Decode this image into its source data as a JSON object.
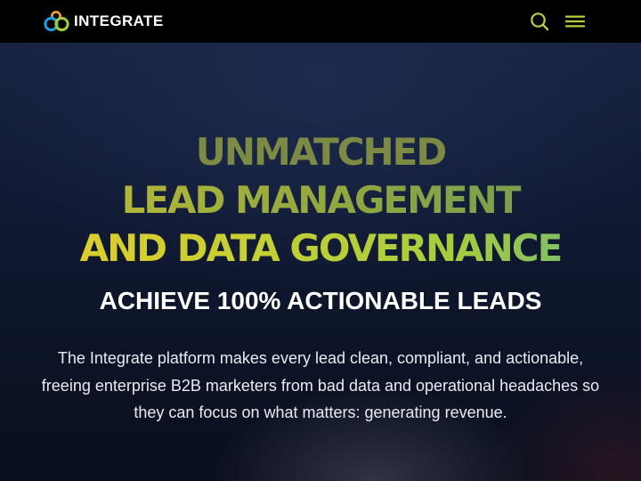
{
  "header": {
    "brand_name": "INTEGRATE",
    "logo_icon": "integrate-rings-logo-icon",
    "search_icon": "search-icon",
    "menu_icon": "hamburger-menu-icon",
    "accent_color": "#b5cf3f",
    "background_color": "#000000"
  },
  "hero": {
    "headline_lines": [
      "UNMATCHED",
      "LEAD MANAGEMENT",
      "AND DATA GOVERNANCE"
    ],
    "subheadline": "ACHIEVE 100% ACTIONABLE LEADS",
    "description": "The Integrate platform makes every lead clean, compliant, and actionable, freeing enterprise B2B marketers from bad data and operational headaches so they can focus on what matters: generating revenue.",
    "headline_gradient_colors": [
      "#e5cc2c",
      "#a8cc3d",
      "#69b77e"
    ],
    "background_color": "#0f1830"
  }
}
